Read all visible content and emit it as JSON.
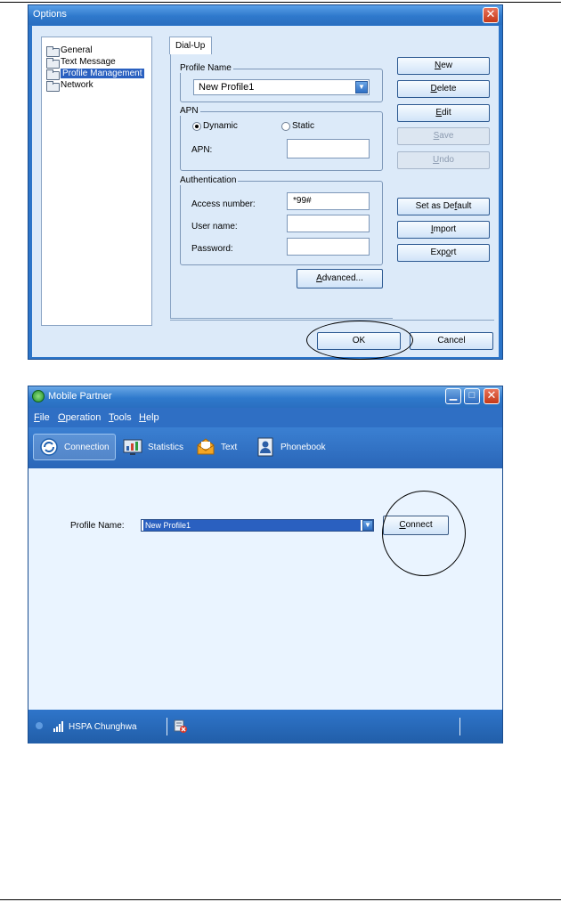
{
  "options_dialog": {
    "title": "Options",
    "tree": [
      "General",
      "Text Message",
      "Profile Management",
      "Network"
    ],
    "tab": "Dial-Up",
    "profile_name_group": "Profile Name",
    "profile_value": "New Profile1",
    "apn_group": "APN",
    "radio_dynamic": "Dynamic",
    "radio_static": "Static",
    "selected_radio": "Dynamic",
    "apn_label": "APN:",
    "apn_value": "",
    "auth_group": "Authentication",
    "access_label": "Access number:",
    "access_value": "*99#",
    "user_label": "User name:",
    "user_value": "",
    "password_label": "Password:",
    "password_value": "",
    "advanced": {
      "pre": "",
      "key": "A",
      "post": "dvanced..."
    },
    "side_buttons": {
      "new": {
        "pre": "",
        "key": "N",
        "post": "ew"
      },
      "delete": {
        "pre": "",
        "key": "D",
        "post": "elete"
      },
      "edit": {
        "pre": "",
        "key": "E",
        "post": "dit"
      },
      "save": {
        "pre": "",
        "key": "S",
        "post": "ave"
      },
      "undo": {
        "pre": "",
        "key": "U",
        "post": "ndo"
      },
      "set_default": {
        "pre": "Set as De",
        "key": "f",
        "post": "ault"
      },
      "import": {
        "pre": "",
        "key": "I",
        "post": "mport"
      },
      "export": {
        "pre": "Exp",
        "key": "o",
        "post": "rt"
      }
    },
    "ok": "OK",
    "cancel": "Cancel"
  },
  "mobile_partner": {
    "title": "Mobile Partner",
    "menu": {
      "file": {
        "pre": "",
        "key": "F",
        "post": "ile"
      },
      "operation": {
        "pre": "",
        "key": "O",
        "post": "peration"
      },
      "tools": {
        "pre": "",
        "key": "T",
        "post": "ools"
      },
      "help": {
        "pre": "",
        "key": "H",
        "post": "elp"
      }
    },
    "toolbar": [
      "Connection",
      "Statistics",
      "Text",
      "Phonebook"
    ],
    "profile_label": "Profile Name:",
    "profile_value": "New Profile1",
    "connect": {
      "pre": "",
      "key": "C",
      "post": "onnect"
    },
    "status_network": "HSPA Chunghwa"
  },
  "colors": {
    "titlebar_blue": "#2f79cc",
    "close_red": "#c43817",
    "dialog_bg": "#dceaf9",
    "selection_blue": "#2a60c0"
  }
}
